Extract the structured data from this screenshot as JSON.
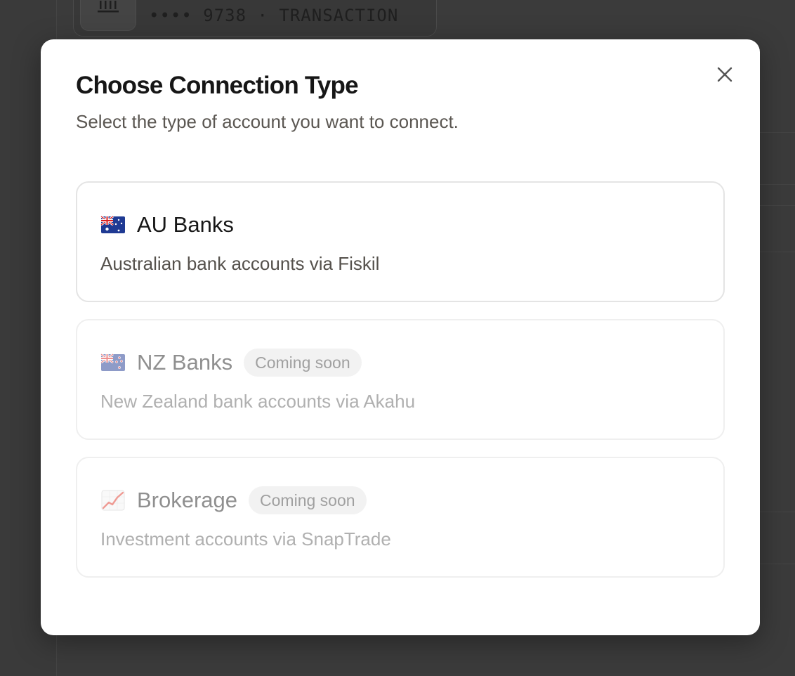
{
  "background": {
    "account_masked": "•••• 9738 · TRANSACTION",
    "bank_icon": "bank-icon"
  },
  "modal": {
    "title": "Choose Connection Type",
    "subtitle": "Select the type of account you want to connect.",
    "close_icon": "close-icon"
  },
  "options": [
    {
      "icon": "australia-flag-icon",
      "label": "AU Banks",
      "description": "Australian bank accounts via Fiskil",
      "badge": "",
      "enabled": true
    },
    {
      "icon": "new-zealand-flag-icon",
      "label": "NZ Banks",
      "description": "New Zealand bank accounts via Akahu",
      "badge": "Coming soon",
      "enabled": false
    },
    {
      "icon": "chart-increasing-icon",
      "label": "Brokerage",
      "description": "Investment accounts via SnapTrade",
      "badge": "Coming soon",
      "enabled": false
    }
  ]
}
